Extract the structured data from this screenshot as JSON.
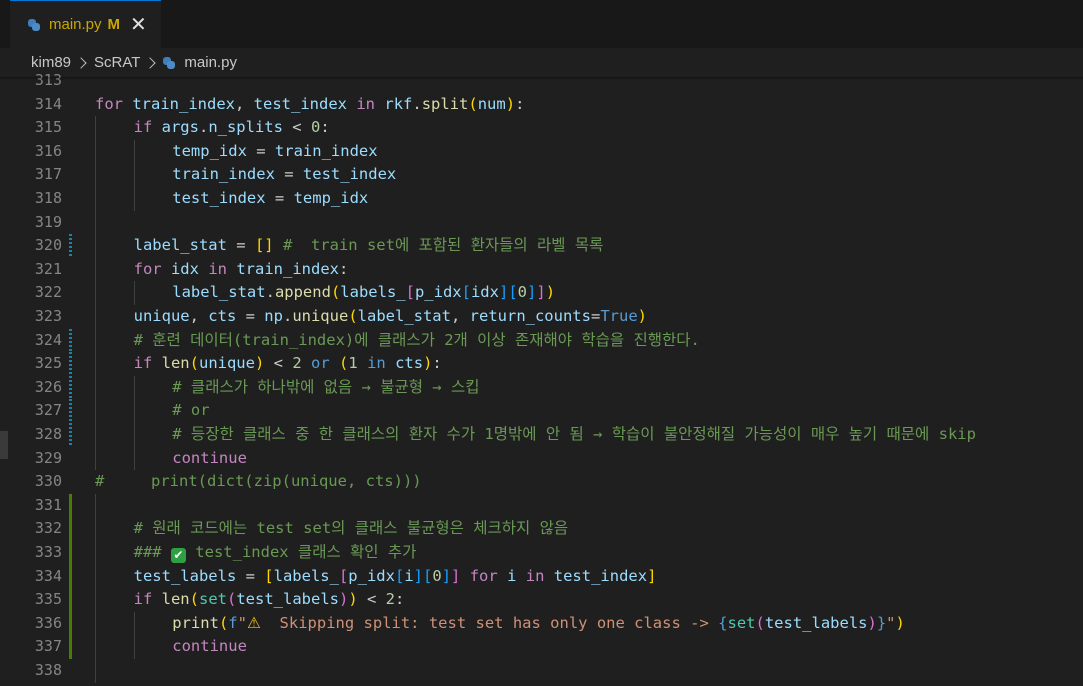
{
  "tab": {
    "filename": "main.py",
    "status": "M",
    "close_glyph": "✕",
    "icon": "python-icon"
  },
  "breadcrumb": {
    "root": "kim89",
    "folder": "ScRAT",
    "file": "main.py"
  },
  "colors": {
    "modified_gutter": "#1b81a8",
    "added_gutter": "#487e02",
    "tab_accent": "#0078d4"
  },
  "editor": {
    "lines": [
      {
        "num": "313",
        "gutter": "none",
        "indent": 0,
        "tokens": []
      },
      {
        "num": "314",
        "gutter": "none",
        "indent": 0,
        "tokens": [
          {
            "c": "c",
            "t": "for"
          },
          {
            "c": "t",
            "t": " "
          },
          {
            "c": "v",
            "t": "train_index"
          },
          {
            "c": "t",
            "t": ", "
          },
          {
            "c": "v",
            "t": "test_index"
          },
          {
            "c": "t",
            "t": " "
          },
          {
            "c": "c",
            "t": "in"
          },
          {
            "c": "t",
            "t": " "
          },
          {
            "c": "v",
            "t": "rkf"
          },
          {
            "c": "t",
            "t": "."
          },
          {
            "c": "f",
            "t": "split"
          },
          {
            "c": "p1",
            "t": "("
          },
          {
            "c": "v",
            "t": "num"
          },
          {
            "c": "p1",
            "t": ")"
          },
          {
            "c": "t",
            "t": ":"
          }
        ]
      },
      {
        "num": "315",
        "gutter": "none",
        "indent": 1,
        "tokens": [
          {
            "c": "c",
            "t": "if"
          },
          {
            "c": "t",
            "t": " "
          },
          {
            "c": "v",
            "t": "args"
          },
          {
            "c": "t",
            "t": "."
          },
          {
            "c": "v",
            "t": "n_splits"
          },
          {
            "c": "t",
            "t": " < "
          },
          {
            "c": "n",
            "t": "0"
          },
          {
            "c": "t",
            "t": ":"
          }
        ]
      },
      {
        "num": "316",
        "gutter": "none",
        "indent": 2,
        "tokens": [
          {
            "c": "v",
            "t": "temp_idx"
          },
          {
            "c": "t",
            "t": " = "
          },
          {
            "c": "v",
            "t": "train_index"
          }
        ]
      },
      {
        "num": "317",
        "gutter": "none",
        "indent": 2,
        "tokens": [
          {
            "c": "v",
            "t": "train_index"
          },
          {
            "c": "t",
            "t": " = "
          },
          {
            "c": "v",
            "t": "test_index"
          }
        ]
      },
      {
        "num": "318",
        "gutter": "none",
        "indent": 2,
        "tokens": [
          {
            "c": "v",
            "t": "test_index"
          },
          {
            "c": "t",
            "t": " = "
          },
          {
            "c": "v",
            "t": "temp_idx"
          }
        ]
      },
      {
        "num": "319",
        "gutter": "none",
        "indent": 1,
        "tokens": []
      },
      {
        "num": "320",
        "gutter": "mod",
        "indent": 1,
        "tokens": [
          {
            "c": "v",
            "t": "label_stat"
          },
          {
            "c": "t",
            "t": " = "
          },
          {
            "c": "p1",
            "t": "[]"
          },
          {
            "c": "t",
            "t": " "
          },
          {
            "c": "cm",
            "t": "#  train set에 포함된 환자들의 라벨 목록"
          }
        ]
      },
      {
        "num": "321",
        "gutter": "none",
        "indent": 1,
        "tokens": [
          {
            "c": "c",
            "t": "for"
          },
          {
            "c": "t",
            "t": " "
          },
          {
            "c": "v",
            "t": "idx"
          },
          {
            "c": "t",
            "t": " "
          },
          {
            "c": "c",
            "t": "in"
          },
          {
            "c": "t",
            "t": " "
          },
          {
            "c": "v",
            "t": "train_index"
          },
          {
            "c": "t",
            "t": ":"
          }
        ]
      },
      {
        "num": "322",
        "gutter": "none",
        "indent": 2,
        "tokens": [
          {
            "c": "v",
            "t": "label_stat"
          },
          {
            "c": "t",
            "t": "."
          },
          {
            "c": "f",
            "t": "append"
          },
          {
            "c": "p1",
            "t": "("
          },
          {
            "c": "v",
            "t": "labels_"
          },
          {
            "c": "p2",
            "t": "["
          },
          {
            "c": "v",
            "t": "p_idx"
          },
          {
            "c": "p3",
            "t": "["
          },
          {
            "c": "v",
            "t": "idx"
          },
          {
            "c": "p3",
            "t": "]"
          },
          {
            "c": "p3",
            "t": "["
          },
          {
            "c": "n",
            "t": "0"
          },
          {
            "c": "p3",
            "t": "]"
          },
          {
            "c": "p2",
            "t": "]"
          },
          {
            "c": "p1",
            "t": ")"
          }
        ]
      },
      {
        "num": "323",
        "gutter": "none",
        "indent": 1,
        "tokens": [
          {
            "c": "v",
            "t": "unique"
          },
          {
            "c": "t",
            "t": ", "
          },
          {
            "c": "v",
            "t": "cts"
          },
          {
            "c": "t",
            "t": " = "
          },
          {
            "c": "v",
            "t": "np"
          },
          {
            "c": "t",
            "t": "."
          },
          {
            "c": "f",
            "t": "unique"
          },
          {
            "c": "p1",
            "t": "("
          },
          {
            "c": "v",
            "t": "label_stat"
          },
          {
            "c": "t",
            "t": ", "
          },
          {
            "c": "v",
            "t": "return_counts"
          },
          {
            "c": "t",
            "t": "="
          },
          {
            "c": "k",
            "t": "True"
          },
          {
            "c": "p1",
            "t": ")"
          }
        ]
      },
      {
        "num": "324",
        "gutter": "mod",
        "indent": 1,
        "tokens": [
          {
            "c": "cm",
            "t": "# 훈련 데이터(train_index)에 클래스가 2개 이상 존재해야 학습을 진행한다."
          }
        ]
      },
      {
        "num": "325",
        "gutter": "mod",
        "indent": 1,
        "tokens": [
          {
            "c": "c",
            "t": "if"
          },
          {
            "c": "t",
            "t": " "
          },
          {
            "c": "f",
            "t": "len"
          },
          {
            "c": "p1",
            "t": "("
          },
          {
            "c": "v",
            "t": "unique"
          },
          {
            "c": "p1",
            "t": ")"
          },
          {
            "c": "t",
            "t": " < "
          },
          {
            "c": "n",
            "t": "2"
          },
          {
            "c": "t",
            "t": " "
          },
          {
            "c": "k",
            "t": "or"
          },
          {
            "c": "t",
            "t": " "
          },
          {
            "c": "p1",
            "t": "("
          },
          {
            "c": "n",
            "t": "1"
          },
          {
            "c": "t",
            "t": " "
          },
          {
            "c": "k",
            "t": "in"
          },
          {
            "c": "t",
            "t": " "
          },
          {
            "c": "v",
            "t": "cts"
          },
          {
            "c": "p1",
            "t": ")"
          },
          {
            "c": "t",
            "t": ":"
          }
        ]
      },
      {
        "num": "326",
        "gutter": "mod",
        "indent": 2,
        "tokens": [
          {
            "c": "cm",
            "t": "# 클래스가 하나밖에 없음 → 불균형 → 스킵"
          }
        ]
      },
      {
        "num": "327",
        "gutter": "mod",
        "indent": 2,
        "tokens": [
          {
            "c": "cm",
            "t": "# or"
          }
        ]
      },
      {
        "num": "328",
        "gutter": "mod",
        "indent": 2,
        "tokens": [
          {
            "c": "cm",
            "t": "# 등장한 클래스 중 한 클래스의 환자 수가 1명밖에 안 됨 → 학습이 불안정해질 가능성이 매우 높기 때문에 skip"
          }
        ]
      },
      {
        "num": "329",
        "gutter": "none",
        "indent": 2,
        "tokens": [
          {
            "c": "c",
            "t": "continue"
          }
        ]
      },
      {
        "num": "330",
        "gutter": "none",
        "indent": 0,
        "tokens": [
          {
            "c": "cm",
            "t": "#     print(dict(zip(unique, cts)))"
          }
        ]
      },
      {
        "num": "331",
        "gutter": "add",
        "indent": 1,
        "tokens": []
      },
      {
        "num": "332",
        "gutter": "add",
        "indent": 1,
        "tokens": [
          {
            "c": "cm",
            "t": "# 원래 코드에는 test set의 클래스 불균형은 체크하지 않음"
          }
        ]
      },
      {
        "num": "333",
        "gutter": "add",
        "indent": 1,
        "tokens": [
          {
            "c": "cm",
            "t": "### "
          },
          {
            "c": "check",
            "t": "✔"
          },
          {
            "c": "cm",
            "t": " test_index 클래스 확인 추가"
          }
        ]
      },
      {
        "num": "334",
        "gutter": "add",
        "indent": 1,
        "tokens": [
          {
            "c": "v",
            "t": "test_labels"
          },
          {
            "c": "t",
            "t": " = "
          },
          {
            "c": "p1",
            "t": "["
          },
          {
            "c": "v",
            "t": "labels_"
          },
          {
            "c": "p2",
            "t": "["
          },
          {
            "c": "v",
            "t": "p_idx"
          },
          {
            "c": "p3",
            "t": "["
          },
          {
            "c": "v",
            "t": "i"
          },
          {
            "c": "p3",
            "t": "]"
          },
          {
            "c": "p3",
            "t": "["
          },
          {
            "c": "n",
            "t": "0"
          },
          {
            "c": "p3",
            "t": "]"
          },
          {
            "c": "p2",
            "t": "]"
          },
          {
            "c": "t",
            "t": " "
          },
          {
            "c": "c",
            "t": "for"
          },
          {
            "c": "t",
            "t": " "
          },
          {
            "c": "v",
            "t": "i"
          },
          {
            "c": "t",
            "t": " "
          },
          {
            "c": "c",
            "t": "in"
          },
          {
            "c": "t",
            "t": " "
          },
          {
            "c": "v",
            "t": "test_index"
          },
          {
            "c": "p1",
            "t": "]"
          }
        ]
      },
      {
        "num": "335",
        "gutter": "add",
        "indent": 1,
        "tokens": [
          {
            "c": "c",
            "t": "if"
          },
          {
            "c": "t",
            "t": " "
          },
          {
            "c": "f",
            "t": "len"
          },
          {
            "c": "p1",
            "t": "("
          },
          {
            "c": "cl",
            "t": "set"
          },
          {
            "c": "p2",
            "t": "("
          },
          {
            "c": "v",
            "t": "test_labels"
          },
          {
            "c": "p2",
            "t": ")"
          },
          {
            "c": "p1",
            "t": ")"
          },
          {
            "c": "t",
            "t": " < "
          },
          {
            "c": "n",
            "t": "2"
          },
          {
            "c": "t",
            "t": ":"
          }
        ]
      },
      {
        "num": "336",
        "gutter": "add",
        "indent": 2,
        "tokens": [
          {
            "c": "f",
            "t": "print"
          },
          {
            "c": "p1",
            "t": "("
          },
          {
            "c": "k",
            "t": "f"
          },
          {
            "c": "s",
            "t": "\""
          },
          {
            "c": "warn",
            "t": "⚠"
          },
          {
            "c": "s",
            "t": "  Skipping split: test set has only one class -> "
          },
          {
            "c": "k",
            "t": "{"
          },
          {
            "c": "cl",
            "t": "set"
          },
          {
            "c": "p2",
            "t": "("
          },
          {
            "c": "v",
            "t": "test_labels"
          },
          {
            "c": "p2",
            "t": ")"
          },
          {
            "c": "k",
            "t": "}"
          },
          {
            "c": "s",
            "t": "\""
          },
          {
            "c": "p1",
            "t": ")"
          }
        ]
      },
      {
        "num": "337",
        "gutter": "add",
        "indent": 2,
        "tokens": [
          {
            "c": "c",
            "t": "continue"
          }
        ]
      },
      {
        "num": "338",
        "gutter": "none",
        "indent": 1,
        "tokens": []
      }
    ]
  }
}
